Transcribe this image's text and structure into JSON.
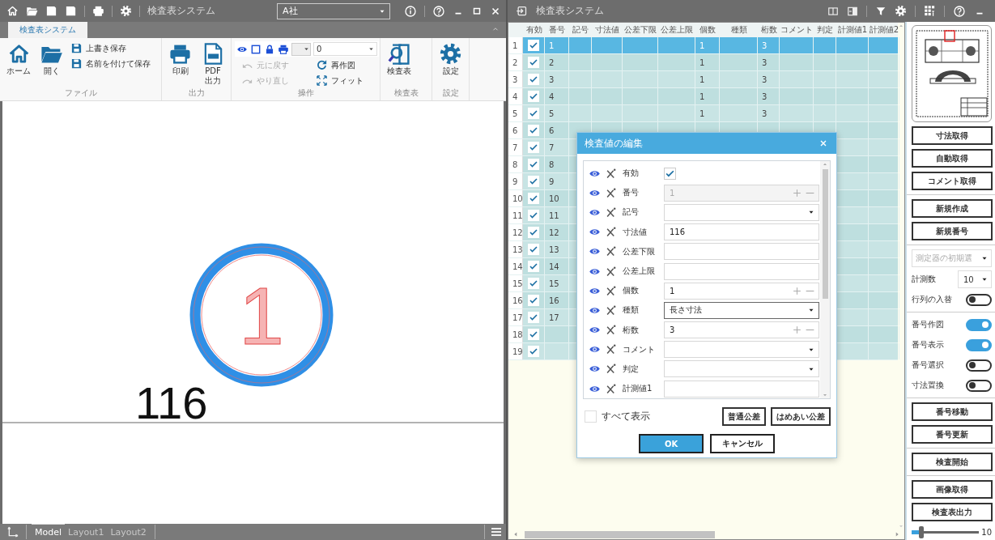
{
  "left_window": {
    "toolbar_title": "検査表システム",
    "company_select": "A社",
    "ribbon_tabs": [
      {
        "label": "検査表システム",
        "selected": true
      }
    ],
    "ribbon": {
      "file": {
        "label": "ファイル",
        "home": "ホーム",
        "open": "開く",
        "overwrite_save": "上書き保存",
        "save_as": "名前を付けて保存"
      },
      "output": {
        "label": "出力",
        "print": "印刷",
        "pdf": "PDF 出力"
      },
      "operation": {
        "label": "操作",
        "layer_select": "0",
        "undo": {
          "label": "元に戻す",
          "disabled": true
        },
        "redo": {
          "label": "やり直し",
          "disabled": true
        },
        "redraw": {
          "label": "再作図",
          "disabled": false
        },
        "fit": {
          "label": "フィット",
          "disabled": false
        }
      },
      "inspection_sheet": {
        "label": "検査表",
        "button": "検査表"
      },
      "settings": {
        "label": "設定",
        "button": "設定"
      }
    },
    "canvas": {
      "balloon_number": "1",
      "dimension": "116"
    },
    "layout_tabs": [
      {
        "label": "Model",
        "selected": true
      },
      {
        "label": "Layout1",
        "selected": false
      },
      {
        "label": "Layout2",
        "selected": false
      }
    ]
  },
  "right_window": {
    "title": "検査表システム",
    "table": {
      "columns": [
        "有効",
        "番号",
        "記号",
        "寸法値",
        "公差下限",
        "公差上限",
        "個数",
        "種類",
        "桁数",
        "コメント",
        "判定",
        "計測値1",
        "計測値2"
      ],
      "rows": [
        {
          "row": "1",
          "valid": true,
          "number": "1",
          "count": "1",
          "digits": "3",
          "selected": true
        },
        {
          "row": "2",
          "valid": true,
          "number": "2",
          "count": "1",
          "digits": "3",
          "selected": false
        },
        {
          "row": "3",
          "valid": true,
          "number": "3",
          "count": "1",
          "digits": "3",
          "selected": false
        },
        {
          "row": "4",
          "valid": true,
          "number": "4",
          "count": "1",
          "digits": "3",
          "selected": false
        },
        {
          "row": "5",
          "valid": true,
          "number": "5",
          "count": "1",
          "digits": "3",
          "selected": false
        },
        {
          "row": "6",
          "valid": true,
          "number": "6",
          "selected": false
        },
        {
          "row": "7",
          "valid": true,
          "number": "7",
          "selected": false
        },
        {
          "row": "8",
          "valid": true,
          "number": "8",
          "selected": false
        },
        {
          "row": "9",
          "valid": true,
          "number": "9",
          "selected": false
        },
        {
          "row": "10",
          "valid": true,
          "number": "10",
          "selected": false
        },
        {
          "row": "11",
          "valid": true,
          "number": "11",
          "selected": false
        },
        {
          "row": "12",
          "valid": true,
          "number": "12",
          "selected": false
        },
        {
          "row": "13",
          "valid": true,
          "number": "13",
          "selected": false
        },
        {
          "row": "14",
          "valid": true,
          "number": "14",
          "selected": false
        },
        {
          "row": "15",
          "valid": true,
          "number": "15",
          "selected": false
        },
        {
          "row": "16",
          "valid": true,
          "number": "16",
          "selected": false
        },
        {
          "row": "17",
          "valid": true,
          "number": "17",
          "selected": false
        },
        {
          "row": "18",
          "valid": true,
          "selected": false
        },
        {
          "row": "19",
          "valid": true,
          "selected": false
        }
      ]
    },
    "dialog": {
      "title": "検査値の編集",
      "fields": [
        {
          "label": "有効",
          "kind": "checkbox",
          "checked": true
        },
        {
          "label": "番号",
          "kind": "spin",
          "value": "1",
          "disabled": true
        },
        {
          "label": "記号",
          "kind": "select",
          "focused": false
        },
        {
          "label": "寸法値",
          "kind": "text",
          "value": "116"
        },
        {
          "label": "公差下限",
          "kind": "text"
        },
        {
          "label": "公差上限",
          "kind": "text"
        },
        {
          "label": "個数",
          "kind": "spin",
          "value": "1",
          "disabled": false
        },
        {
          "label": "種類",
          "kind": "select",
          "value": "長さ寸法",
          "focused": true
        },
        {
          "label": "桁数",
          "kind": "spin",
          "value": "3",
          "disabled": false
        },
        {
          "label": "コメント",
          "kind": "select",
          "focused": false
        },
        {
          "label": "判定",
          "kind": "select",
          "focused": false
        },
        {
          "label": "計測値1",
          "kind": "text"
        }
      ],
      "show_all": {
        "label": "すべて表示",
        "checked": false
      },
      "tolerance_buttons": [
        "普通公差",
        "はめあい公差"
      ],
      "ok": "OK",
      "cancel": "キャンセル"
    },
    "side_panel": {
      "button_groups_top": [
        [
          "寸法取得",
          "自動取得",
          "コメント取得"
        ],
        [
          "新規作成",
          "新規番号"
        ]
      ],
      "instrument_select": {
        "placeholder": "測定器の初期選"
      },
      "count": {
        "label": "計測数",
        "value": "10"
      },
      "toggles": [
        {
          "label": "行列の入替",
          "on": false
        },
        {
          "label": "番号作図",
          "on": true
        },
        {
          "label": "番号表示",
          "on": true
        },
        {
          "label": "番号選択",
          "on": false
        },
        {
          "label": "寸法置換",
          "on": false
        }
      ],
      "button_groups_bottom": [
        [
          "番号移動",
          "番号更新"
        ],
        [
          "検査開始"
        ],
        [
          "画像取得",
          "検査表出力"
        ]
      ],
      "zoom": {
        "level": 0.15,
        "reading": "10"
      }
    }
  }
}
